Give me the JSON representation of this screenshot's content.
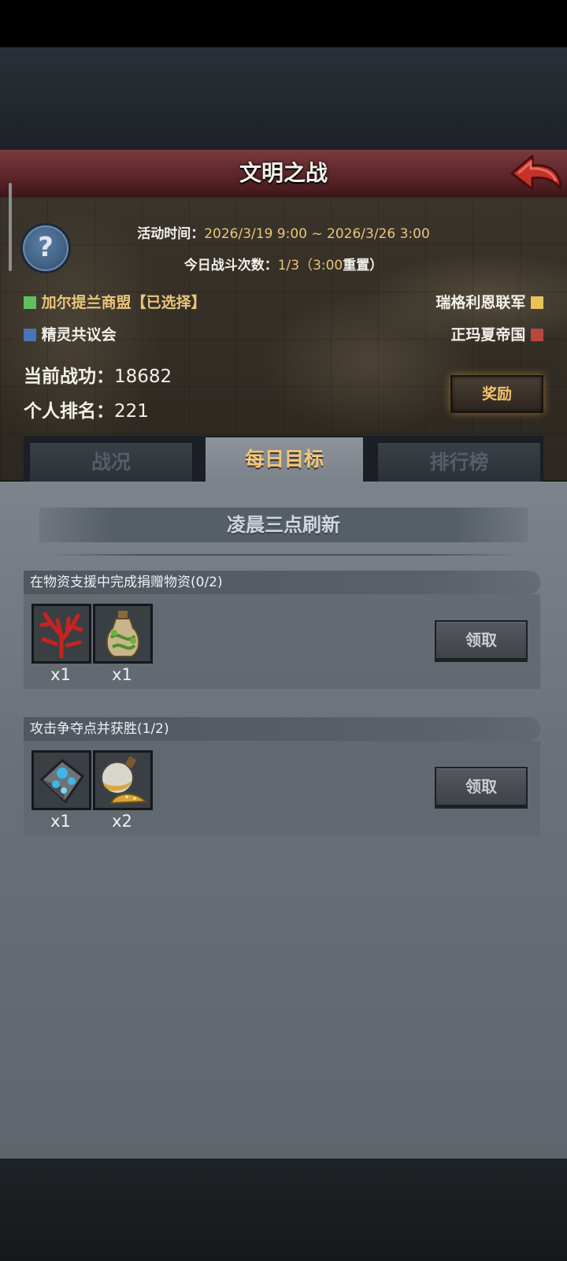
{
  "header": {
    "title": "文明之战"
  },
  "event": {
    "time_label": "活动时间：",
    "time_value": "2026/3/19 9:00 ~ 2026/3/26 3:00",
    "battles_label": "今日战斗次数：",
    "battles_value": "1/3（3:00",
    "battles_reset": "重置）"
  },
  "factions": [
    {
      "name": "加尔提兰商盟【已选择】",
      "color": "#5fbf5f",
      "text_color": "#e9c57a"
    },
    {
      "name": "瑞格利恩联军",
      "color": "#e8c35a",
      "text_color": "#f2f0ea"
    },
    {
      "name": "精灵共议会",
      "color": "#4a74b8",
      "text_color": "#f2f0ea"
    },
    {
      "name": "正玛夏帝国",
      "color": "#b8473f",
      "text_color": "#f2f0ea"
    }
  ],
  "stats": {
    "merit_label": "当前战功：",
    "merit_value": "18682",
    "rank_label": "个人排名：",
    "rank_value": "221"
  },
  "reward_button": "奖励",
  "tabs": [
    {
      "label": "战况",
      "active": false
    },
    {
      "label": "每日目标",
      "active": true
    },
    {
      "label": "排行榜",
      "active": false
    }
  ],
  "refresh_note": "凌晨三点刷新",
  "tasks": [
    {
      "title": "在物资支援中完成捐赠物资(0/2)",
      "items": [
        {
          "icon": "red-coral-icon",
          "qty": "x1"
        },
        {
          "icon": "vine-potion-icon",
          "qty": "x1"
        }
      ],
      "button": "领取"
    },
    {
      "title": "攻击争夺点并获胜(1/2)",
      "items": [
        {
          "icon": "blue-crystal-ore-icon",
          "qty": "x1"
        },
        {
          "icon": "gold-sand-flask-icon",
          "qty": "x2"
        }
      ],
      "button": "领取"
    }
  ]
}
